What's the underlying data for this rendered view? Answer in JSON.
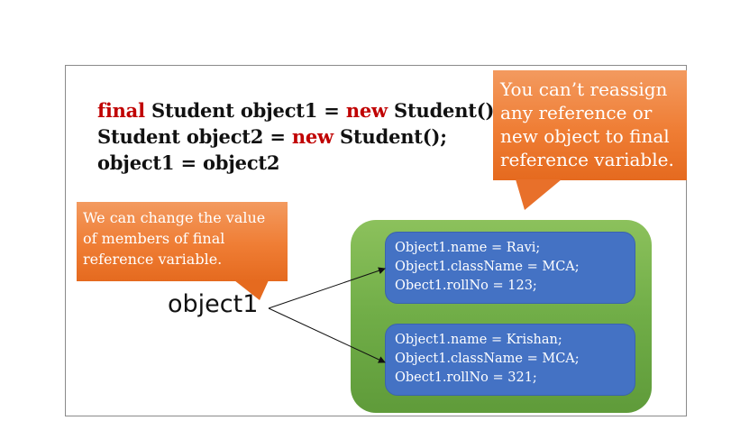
{
  "code": {
    "line1": {
      "kw1": "final",
      "mid": " Student object1 = ",
      "kw2": "new",
      "end": " Student();"
    },
    "line2": {
      "start": "Student object2 = ",
      "kw": "new",
      "end": " Student();"
    },
    "line3": "object1 = object2"
  },
  "callout_top": {
    "lines": [
      "You can’t reassign",
      "any reference or",
      "new object to final",
      "reference variable."
    ]
  },
  "callout_left": {
    "lines": [
      "We can change the value",
      "of members of final",
      "reference variable."
    ]
  },
  "object_label": "object1",
  "objects": [
    {
      "lines": [
        "Object1.name = Ravi;",
        "Object1.className = MCA;",
        "Obect1.rollNo = 123;"
      ]
    },
    {
      "lines": [
        "Object1.name = Krishan;",
        "Object1.className = MCA;",
        "Obect1.rollNo = 321;"
      ]
    }
  ],
  "colors": {
    "keyword": "#c00000",
    "callout": "#ef7d34",
    "container": "#70ad47",
    "object_card": "#4472c4"
  }
}
